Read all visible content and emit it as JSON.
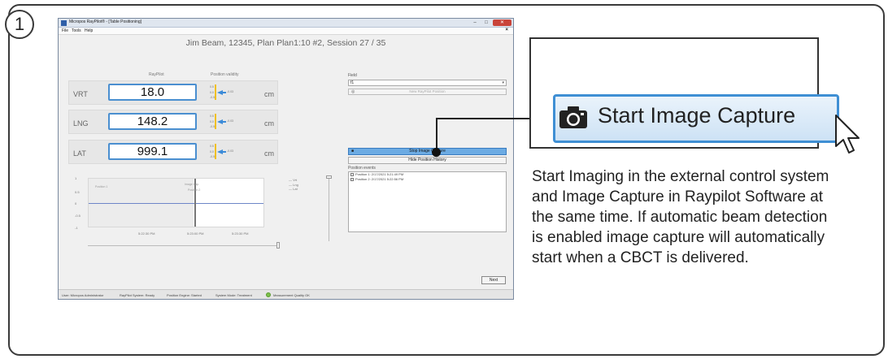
{
  "step": {
    "number": "1"
  },
  "window": {
    "title": "Micropos RayPilot® - [Table Positioning]",
    "controls": {
      "minimize": "–",
      "maximize": "□",
      "close": "✕"
    },
    "menu": [
      "File",
      "Tools",
      "Help"
    ],
    "menu_close": "×"
  },
  "session_title": "Jim Beam, 12345, Plan Plan1:10 #2, Session 27 / 35",
  "positions": {
    "col_raypilot": "RayPilot",
    "col_validity": "Position validity",
    "rows": [
      {
        "axis": "VRT",
        "value": "18.0",
        "unit": "cm",
        "validity_ticks": [
          "0.5",
          "0.0",
          "-0.5"
        ],
        "validity_value": "-0.03"
      },
      {
        "axis": "LNG",
        "value": "148.2",
        "unit": "cm",
        "validity_ticks": [
          "0.5",
          "0.0",
          "-0.5"
        ],
        "validity_value": "-0.03"
      },
      {
        "axis": "LAT",
        "value": "999.1",
        "unit": "cm",
        "validity_ticks": [
          "0.5",
          "0.0",
          "-0.5"
        ],
        "validity_value": "-0.03"
      }
    ]
  },
  "graph": {
    "y_ticks": [
      "1",
      "0.5",
      "0",
      "-0.5",
      "-1"
    ],
    "x_ticks": [
      "5:22:30 PM",
      "5:23:00 PM",
      "5:23:30 PM"
    ],
    "labels": {
      "left": "Position 1",
      "mid_top": "Image Cap.",
      "mid": "Position 2"
    },
    "legend": [
      "Vrt",
      "Lng",
      "Lat"
    ]
  },
  "right_panel": {
    "field_label": "Field",
    "field_value": "f1",
    "new_position_button": "New RayPilot Position",
    "stop_capture_button": "Stop Image Capture",
    "hide_history_button": "Hide Position History",
    "events_label": "Position events",
    "events": [
      "Position 1: 2/17/2021 5:21:49 PM",
      "Position 2: 2/17/2021 5:22:56 PM"
    ],
    "next_button": "Next"
  },
  "statusbar": {
    "user": "User: Micropos Administrator",
    "system": "RayPilot System: Ready",
    "engine": "Position Engine: Started",
    "mode": "System Mode: Treatment",
    "quality": "Measurement Quality OK"
  },
  "callout": {
    "button_label": "Start Image Capture",
    "icon": "camera-icon",
    "cursor": "mouse-pointer-icon",
    "description": "Start Imaging in the external control system and Image Capture in Raypilot Software at the same time. If automatic beam detection is enabled image capture will automatically start when a CBCT is delivered."
  },
  "colors": {
    "accent": "#3f8fd4",
    "stop_button": "#6cabe3",
    "validity_bar": "#f0c020",
    "status_ok": "#7cc04a"
  }
}
